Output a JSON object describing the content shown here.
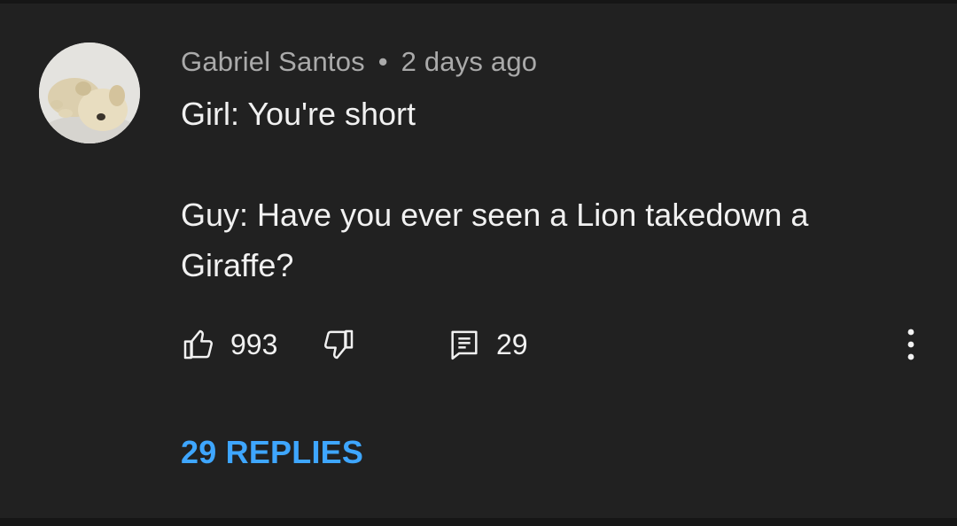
{
  "comment": {
    "author": "Gabriel Santos",
    "separator": "•",
    "time": "2 days ago",
    "lines": [
      "Girl: You're short",
      "Guy: Have you ever seen a Lion takedown a Giraffe?"
    ],
    "likes": "993",
    "reply_count": "29",
    "replies_link": "29 REPLIES"
  },
  "icons": {
    "like": "thumbs-up-icon",
    "dislike": "thumbs-down-icon",
    "reply": "comment-icon",
    "menu": "more-vert-icon"
  },
  "colors": {
    "background": "#212121",
    "text": "#f1f1f1",
    "meta": "#aaaaaa",
    "link": "#3ea6ff"
  }
}
